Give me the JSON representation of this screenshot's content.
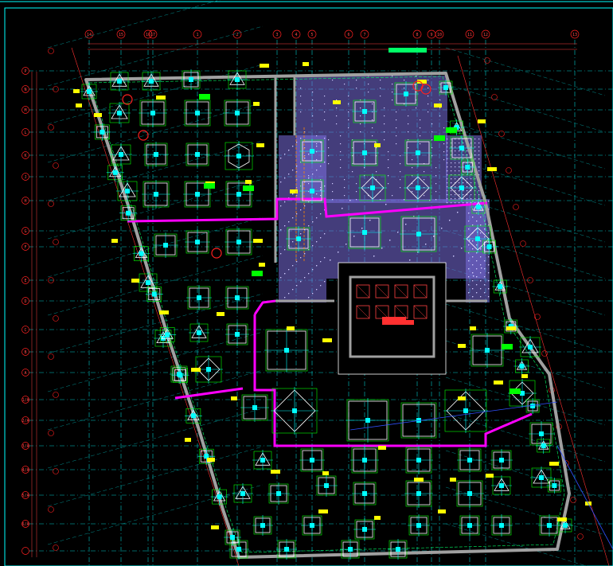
{
  "drawing": {
    "column_axes": [
      "14",
      "15",
      "16",
      "17",
      "1",
      "2",
      "3",
      "4",
      "5",
      "6",
      "7",
      "8",
      "9",
      "10",
      "11",
      "12",
      "13"
    ],
    "row_axes": [
      "P",
      "N",
      "M",
      "L",
      "K",
      "J",
      "H",
      "G",
      "F",
      "E",
      "D",
      "C",
      "B",
      "A",
      "1/A",
      "2/A",
      "3/A",
      "4/A",
      "5/A",
      "6/A"
    ],
    "colors": {
      "background": "#000000",
      "frame": "#00ffff",
      "grid_main": "#00c8c8",
      "grid_dash": "#008c8c",
      "wall": "#a0a0a0",
      "core_hatch": "#7b6fe0",
      "boundary": "#ff00ff",
      "pile_cap": "#00ff00",
      "column": "#00ffff",
      "axis_bubble": "#ff2020",
      "annotation": "#ffff00",
      "dimension": "#ff4040"
    },
    "title_note": "",
    "legend_note": ""
  }
}
